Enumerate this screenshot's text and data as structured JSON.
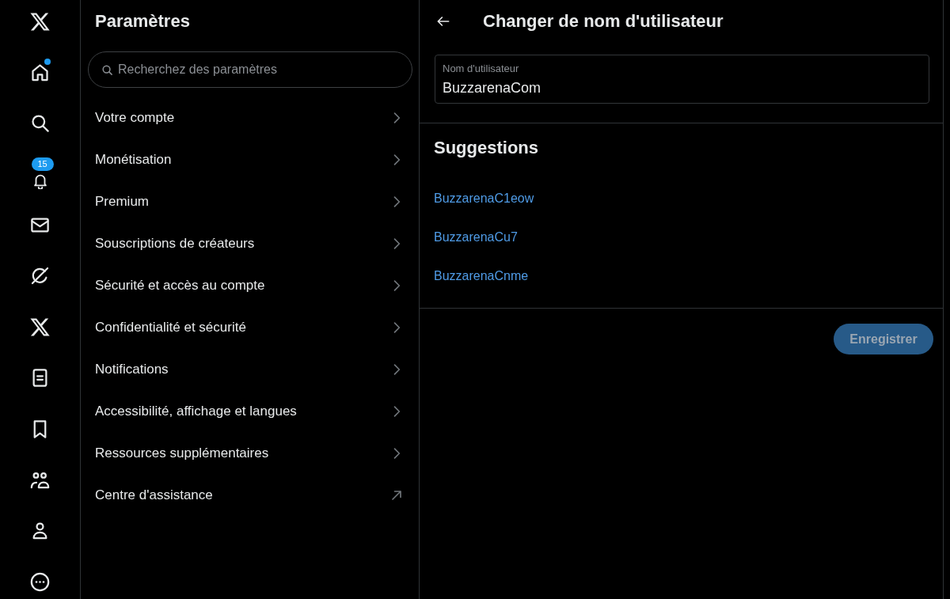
{
  "nav": {
    "items": [
      {
        "kind": "logo",
        "dot": false
      },
      {
        "kind": "home",
        "dot": true
      },
      {
        "kind": "search",
        "dot": false
      },
      {
        "kind": "notifications",
        "dot": false,
        "badge": "15"
      },
      {
        "kind": "messages",
        "dot": false
      },
      {
        "kind": "grok",
        "dot": false
      },
      {
        "kind": "premium",
        "dot": false
      },
      {
        "kind": "lists",
        "dot": false
      },
      {
        "kind": "bookmarks",
        "dot": false
      },
      {
        "kind": "communities",
        "dot": false
      },
      {
        "kind": "profile",
        "dot": false
      },
      {
        "kind": "more",
        "dot": false
      }
    ]
  },
  "settings": {
    "title": "Paramètres",
    "search": {
      "placeholder": "Recherchez des paramètres"
    },
    "items": [
      {
        "label": "Votre compte",
        "kind": "submenu"
      },
      {
        "label": "Monétisation",
        "kind": "submenu"
      },
      {
        "label": "Premium",
        "kind": "submenu"
      },
      {
        "label": "Souscriptions de créateurs",
        "kind": "submenu"
      },
      {
        "label": "Sécurité et accès au compte",
        "kind": "submenu"
      },
      {
        "label": "Confidentialité et sécurité",
        "kind": "submenu"
      },
      {
        "label": "Notifications",
        "kind": "submenu"
      },
      {
        "label": "Accessibilité, affichage et langues",
        "kind": "submenu"
      },
      {
        "label": "Ressources supplémentaires",
        "kind": "submenu"
      },
      {
        "label": "Centre d'assistance",
        "kind": "external"
      }
    ]
  },
  "detail": {
    "title": "Changer de nom d'utilisateur",
    "field": {
      "label": "Nom d'utilisateur",
      "value": "BuzzarenaCom"
    },
    "suggestions": {
      "title": "Suggestions",
      "items": [
        "BuzzarenaC1eow",
        "BuzzarenaCu7",
        "BuzzarenaCnme"
      ]
    },
    "save_button": {
      "label": "Enregistrer",
      "disabled": true
    }
  }
}
